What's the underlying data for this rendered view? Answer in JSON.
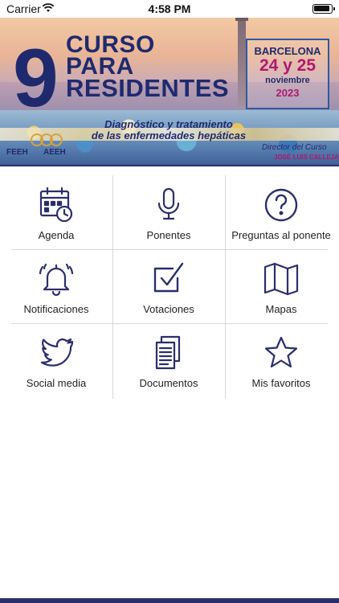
{
  "status_bar": {
    "carrier": "Carrier",
    "time": "4:58 PM"
  },
  "banner": {
    "number": "9",
    "title_lines": [
      "CURSO",
      "PARA",
      "RESIDENTES"
    ],
    "city": "BARCELONA",
    "dates": "24 y 25",
    "month": "noviembre",
    "year": "2023",
    "subtitle_line1": "Diagnóstico y tratamiento",
    "subtitle_line2": "de las enfermedades hepáticas",
    "director_label": "Director del Curso",
    "director_name": "JOSÉ LUIS CALLEJA",
    "logo_left": "FEEH",
    "logo_right": "AEEH",
    "colors": {
      "navy": "#1f2a6e",
      "magenta": "#b0186e"
    }
  },
  "menu": {
    "icon_color": "#2a2f6b",
    "items": [
      {
        "label": "Agenda",
        "icon": "calendar-clock-icon"
      },
      {
        "label": "Ponentes",
        "icon": "microphone-icon"
      },
      {
        "label": "Preguntas al ponente",
        "icon": "question-circle-icon"
      },
      {
        "label": "Notificaciones",
        "icon": "bell-ringing-icon"
      },
      {
        "label": "Votaciones",
        "icon": "checkbox-icon"
      },
      {
        "label": "Mapas",
        "icon": "map-icon"
      },
      {
        "label": "Social media",
        "icon": "twitter-bird-icon"
      },
      {
        "label": "Documentos",
        "icon": "documents-icon"
      },
      {
        "label": "Mis favoritos",
        "icon": "star-icon"
      }
    ]
  }
}
